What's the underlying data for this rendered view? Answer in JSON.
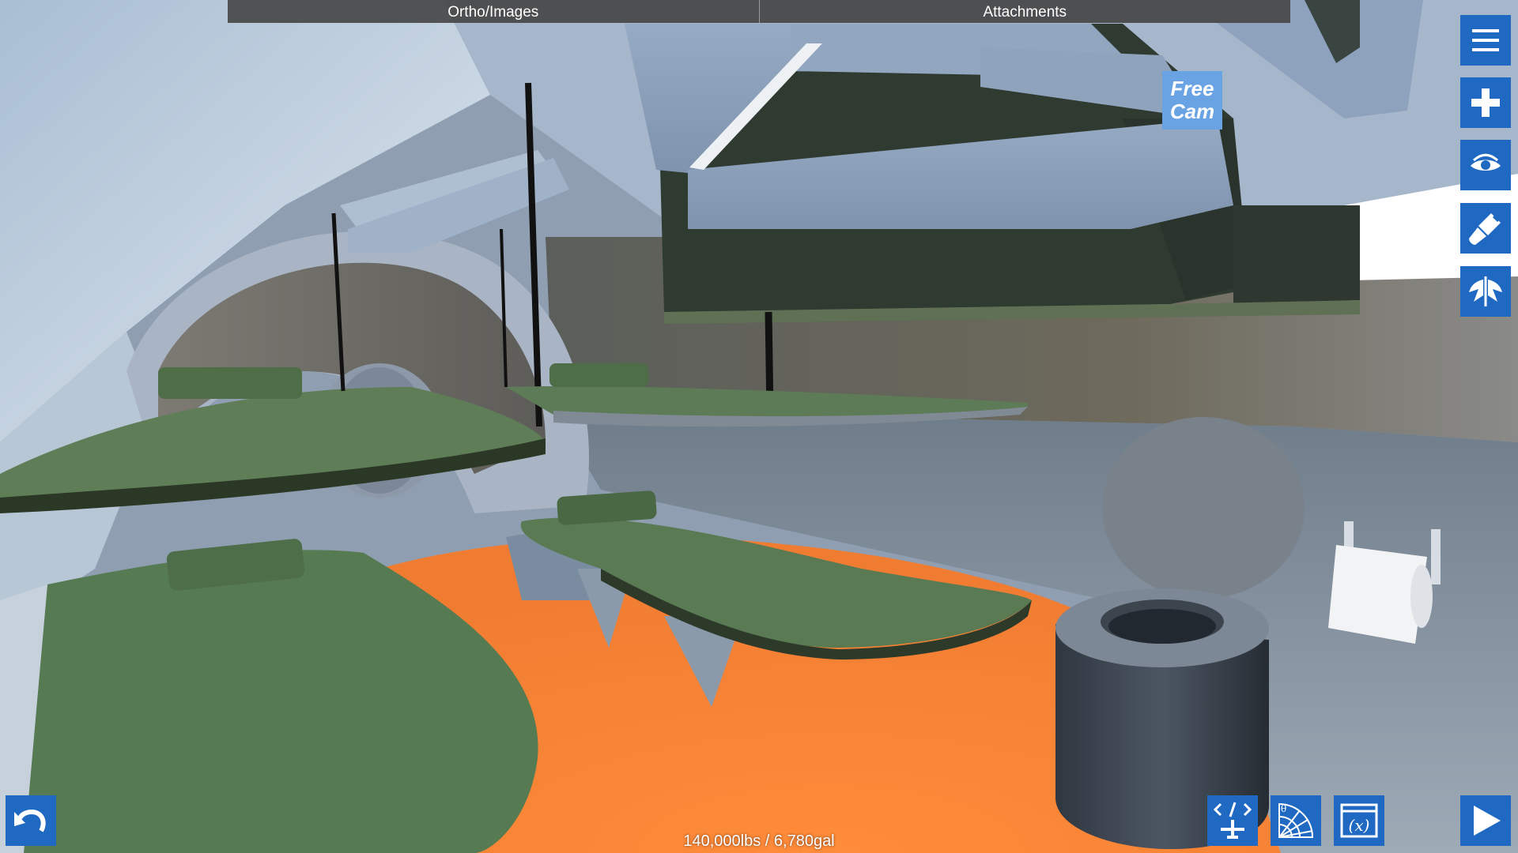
{
  "tabs": [
    {
      "label": "Ortho/Images"
    },
    {
      "label": "Attachments"
    }
  ],
  "camera_badge": {
    "line1": "Free",
    "line2": "Cam"
  },
  "toolbar": {
    "menu_icon": "hamburger-menu-icon",
    "add_icon": "plus-icon",
    "view_icon": "eye-icon",
    "paint_icon": "paintbrush-icon",
    "symmetry_icon": "wing-symmetry-icon"
  },
  "bottom": {
    "undo_icon": "undo-arrow-icon",
    "code_icon": "aircraft-code-icon",
    "angle_icon": "angle-gauge-icon",
    "variables_icon": "variables-icon",
    "play_icon": "play-icon",
    "variables_label": "(x)"
  },
  "status": {
    "weight_fuel": "140,000lbs / 6,780gal"
  },
  "colors": {
    "button_blue": "#1f69c2",
    "badge_blue": "#6aa3e4",
    "floor_orange": "#fb8a3c",
    "seat_green": "#567a52"
  }
}
